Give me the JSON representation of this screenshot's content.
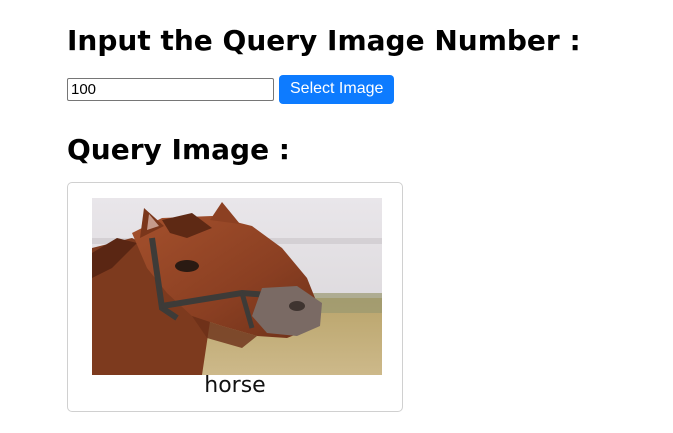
{
  "header": {
    "input_title": "Input the Query Image Number :"
  },
  "query_form": {
    "number_value": "100",
    "select_button_label": "Select Image"
  },
  "query_section": {
    "title": "Query Image :",
    "image_label": "horse"
  }
}
